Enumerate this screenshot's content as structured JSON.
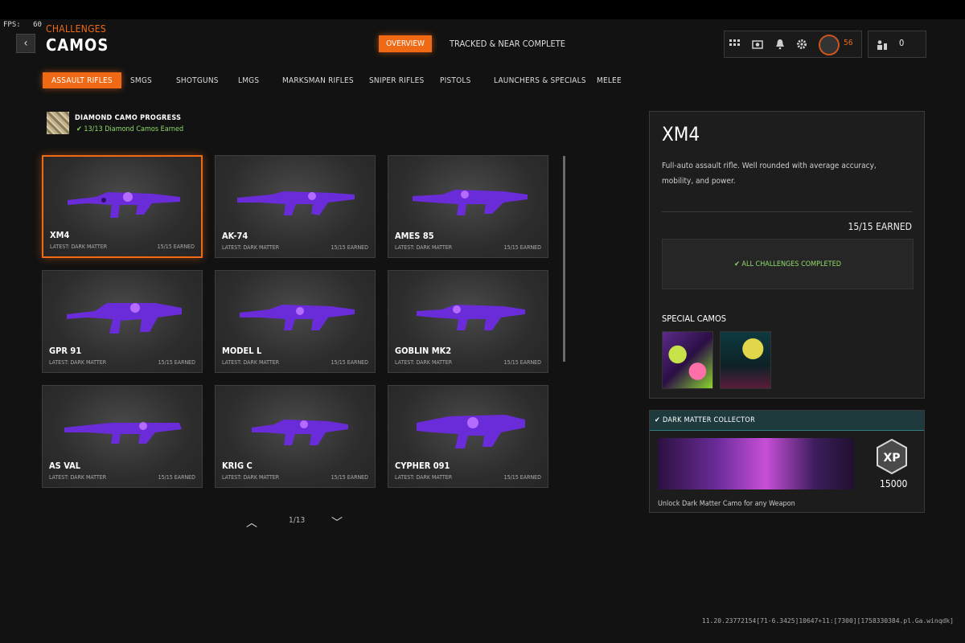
{
  "overlay": {
    "fps_label": "FPS:",
    "fps_value": "60"
  },
  "header": {
    "back_glyph": "‹",
    "subtitle": "CHALLENGES",
    "title": "CAMOS"
  },
  "top_tabs": [
    {
      "label": "OVERVIEW",
      "active": true
    },
    {
      "label": "TRACKED & NEAR COMPLETE",
      "active": false
    }
  ],
  "hud": {
    "icons": [
      "grid-icon",
      "camera-icon",
      "bell-icon",
      "gear-icon"
    ],
    "level": "56",
    "party_count": "0"
  },
  "category_tabs": [
    {
      "label": "ASSAULT RIFLES",
      "active": true
    },
    {
      "label": "SMGS"
    },
    {
      "label": "SHOTGUNS"
    },
    {
      "label": "LMGS"
    },
    {
      "label": "MARKSMAN RIFLES"
    },
    {
      "label": "SNIPER RIFLES"
    },
    {
      "label": "PISTOLS"
    },
    {
      "label": "LAUNCHERS & SPECIALS"
    },
    {
      "label": "MELEE"
    }
  ],
  "diamond": {
    "title": "DIAMOND CAMO PROGRESS",
    "status": "✔ 13/13 Diamond Camos Earned"
  },
  "weapons": [
    {
      "name": "XM4",
      "latest": "LATEST: DARK MATTER",
      "earned": "15/15 EARNED",
      "selected": true
    },
    {
      "name": "AK-74",
      "latest": "LATEST: DARK MATTER",
      "earned": "15/15 EARNED"
    },
    {
      "name": "AMES 85",
      "latest": "LATEST: DARK MATTER",
      "earned": "15/15 EARNED"
    },
    {
      "name": "GPR 91",
      "latest": "LATEST: DARK MATTER",
      "earned": "15/15 EARNED"
    },
    {
      "name": "MODEL L",
      "latest": "LATEST: DARK MATTER",
      "earned": "15/15 EARNED"
    },
    {
      "name": "GOBLIN MK2",
      "latest": "LATEST: DARK MATTER",
      "earned": "15/15 EARNED"
    },
    {
      "name": "AS VAL",
      "latest": "LATEST: DARK MATTER",
      "earned": "15/15 EARNED"
    },
    {
      "name": "KRIG C",
      "latest": "LATEST: DARK MATTER",
      "earned": "15/15 EARNED"
    },
    {
      "name": "CYPHER 091",
      "latest": "LATEST: DARK MATTER",
      "earned": "15/15 EARNED"
    }
  ],
  "pagination": {
    "up_glyph": "︿",
    "page": "1/13",
    "down_glyph": "﹀"
  },
  "detail": {
    "name": "XM4",
    "description": "Full-auto assault rifle.  Well rounded with average accuracy, mobility, and power.",
    "earned": "15/15 EARNED",
    "completed": "✔ ALL CHALLENGES COMPLETED",
    "special_title": "SPECIAL CAMOS"
  },
  "reward": {
    "title": "✔  DARK MATTER COLLECTOR",
    "xp_icon_label": "XP",
    "xp_value": "15000",
    "description": "Unlock Dark Matter Camo for any Weapon"
  },
  "footer": {
    "build": "11.20.23772154[71-6.3425]10647+11:[7300][1758330384.pl.Ga.winqdk]"
  },
  "colors": {
    "accent": "#f06a16",
    "success": "#8fdb6a",
    "reward_header": "#1e3a3d"
  }
}
